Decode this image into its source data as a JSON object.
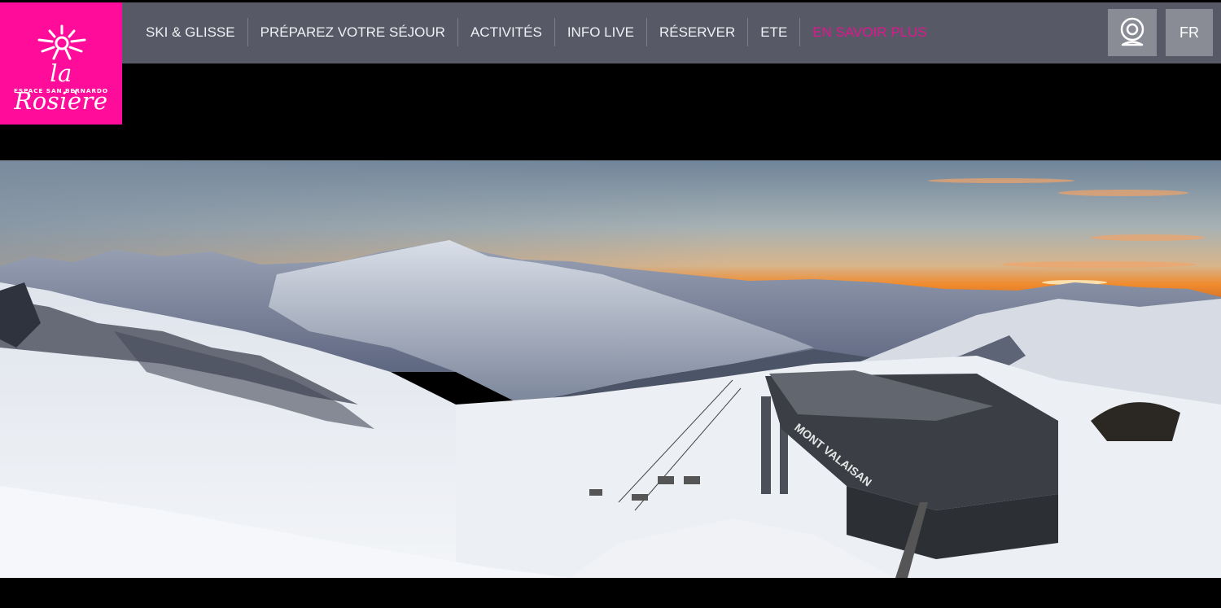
{
  "logo": {
    "name": "la Rosière",
    "subtitle": "ESPACE SAN BERNARDO",
    "icon": "sun-icon"
  },
  "nav": {
    "items": [
      {
        "label": "SKI & GLISSE"
      },
      {
        "label": "PRÉPAREZ VOTRE SÉJOUR"
      },
      {
        "label": "ACTIVITÉS"
      },
      {
        "label": "INFO LIVE"
      },
      {
        "label": "RÉSERVER"
      },
      {
        "label": "ETE"
      },
      {
        "label": "EN SAVOIR PLUS"
      }
    ]
  },
  "header": {
    "webcam_icon": "webcam-icon",
    "language": "FR"
  },
  "panorama": {
    "station_sign": "MONT VALAISAN"
  },
  "colors": {
    "brand_pink": "#ff0d9a",
    "nav_bg": "#575a66",
    "accent_link": "#e0158f",
    "button_bg": "#8a8c95"
  }
}
